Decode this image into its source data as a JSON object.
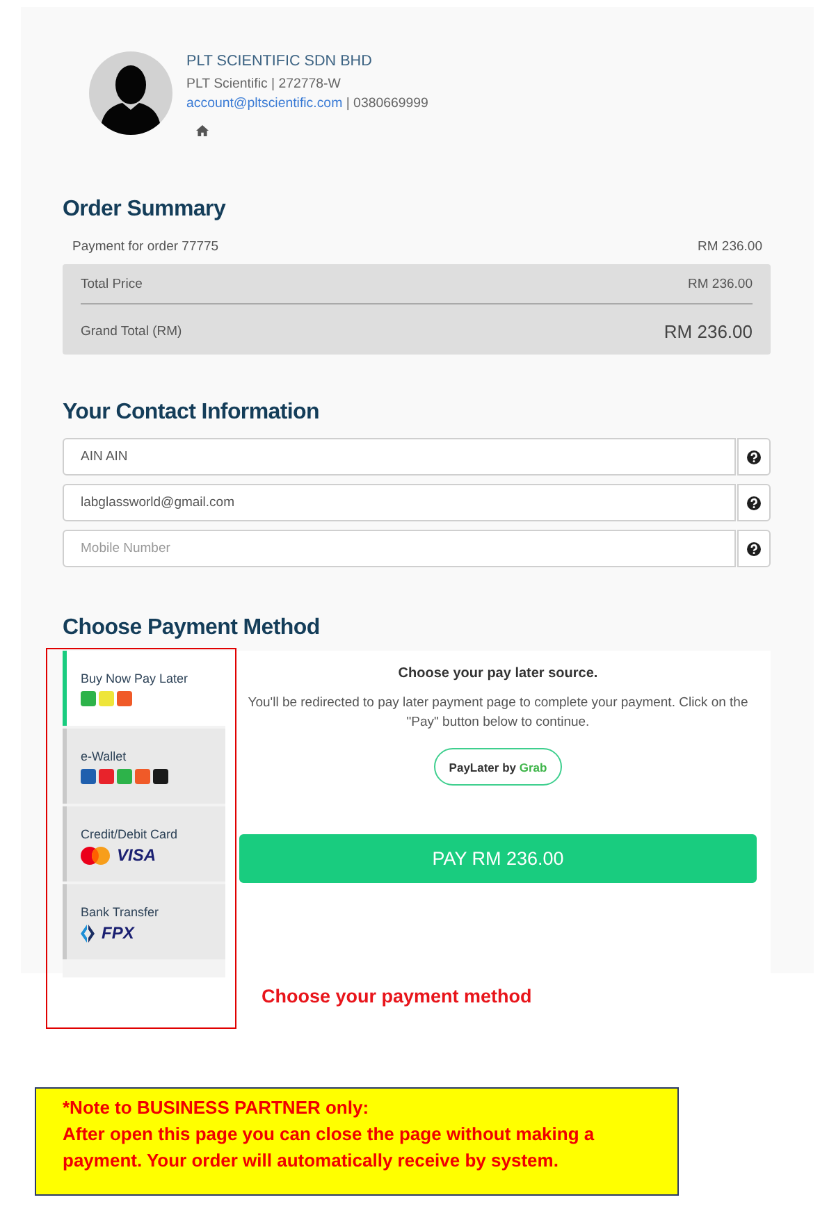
{
  "company": {
    "name": "PLT SCIENTIFIC SDN BHD",
    "registration": "PLT Scientific | 272778-W",
    "email": "account@pltscientific.com",
    "phone": "| 0380669999"
  },
  "order_summary": {
    "title": "Order Summary",
    "line_item": {
      "label": "Payment for order 77775",
      "amount": "RM 236.00"
    },
    "total_price": {
      "label": "Total Price",
      "amount": "RM 236.00"
    },
    "grand_total": {
      "label": "Grand Total (RM)",
      "amount": "RM 236.00"
    }
  },
  "contact": {
    "title": "Your Contact Information",
    "fields": [
      {
        "value": "AIN AIN"
      },
      {
        "value": "labglassworld@gmail.com"
      },
      {
        "placeholder": "Mobile Number"
      }
    ]
  },
  "payment": {
    "title": "Choose Payment Method",
    "tabs": [
      {
        "label": "Buy Now Pay Later",
        "selected": true,
        "logos": [
          {
            "kind": "tile",
            "color": "#2db34a"
          },
          {
            "kind": "tile",
            "color": "#eee53a"
          },
          {
            "kind": "tile",
            "color": "#f05a28"
          }
        ]
      },
      {
        "label": "e-Wallet",
        "selected": false,
        "logos": [
          {
            "kind": "tile",
            "color": "#1f5fae"
          },
          {
            "kind": "tile",
            "color": "#e8232b"
          },
          {
            "kind": "tile",
            "color": "#2db34a"
          },
          {
            "kind": "tile",
            "color": "#f05a28"
          },
          {
            "kind": "tile",
            "color": "#1a1a1a"
          }
        ]
      },
      {
        "label": "Credit/Debit Card",
        "selected": false,
        "logos": [
          {
            "kind": "circles"
          },
          {
            "kind": "wordmark",
            "text": "VISA"
          }
        ]
      },
      {
        "label": "Bank Transfer",
        "selected": false,
        "logos": [
          {
            "kind": "chevrons"
          },
          {
            "kind": "wordmark",
            "text": "FPX"
          }
        ]
      }
    ],
    "panel": {
      "heading": "Choose your pay later source.",
      "text": "You'll be redirected to pay later payment page to complete your payment. Click on the \"Pay\" button below to continue.",
      "source_button": {
        "label": "PayLater by",
        "brand": "Grab"
      }
    },
    "pay_button": "PAY RM 236.00"
  },
  "annotation": {
    "caption": "Choose your payment method"
  },
  "note": {
    "title": "*Note to BUSINESS PARTNER only:",
    "text": "After open this page you can close the page without making a payment. Your order will automatically receive by system."
  }
}
